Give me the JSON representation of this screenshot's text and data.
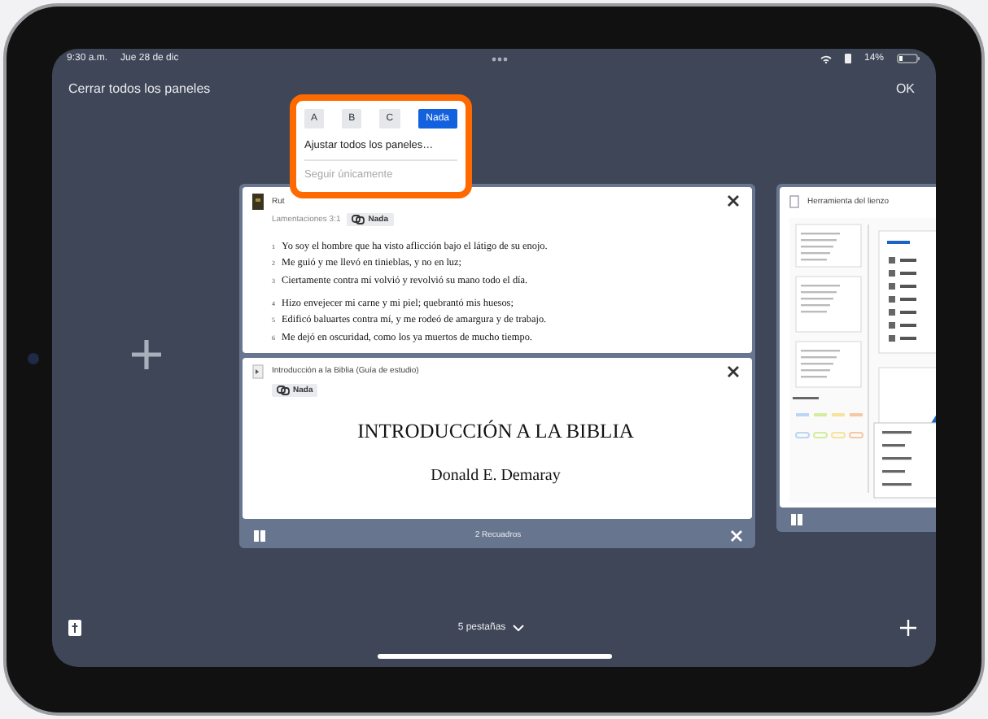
{
  "status_bar": {
    "time": "9:30 a.m.",
    "date": "Jue 28 de dic",
    "battery": "14%"
  },
  "toolbar": {
    "close_all": "Cerrar todos los paneles",
    "done": "OK"
  },
  "popup": {
    "options": [
      {
        "label": "A",
        "selected": false
      },
      {
        "label": "B",
        "selected": false
      },
      {
        "label": "C",
        "selected": false
      },
      {
        "label": "Nada",
        "selected": true
      }
    ],
    "items": [
      {
        "label": "Ajustar todos los paneles…",
        "disabled": false
      },
      {
        "label": "Seguir únicamente",
        "disabled": true
      }
    ]
  },
  "tab_group": {
    "panes": [
      {
        "kind": "bible",
        "title": "Rut",
        "reference": "Lamentaciones 3:1",
        "link": "Nada",
        "paragraphs": [
          {
            "verses": [
              {
                "number": "1",
                "text": "Yo soy el hombre que ha visto aflicción bajo el látigo de su enojo."
              },
              {
                "number": "2",
                "text": "Me guió y me llevó en tinieblas, y no en luz;"
              },
              {
                "number": "3",
                "text": "Ciertamente contra mí volvió y revolvió su mano todo el día."
              }
            ]
          },
          {
            "verses": [
              {
                "number": "4",
                "text": "Hizo envejecer mi carne y mi piel; quebrantó mis huesos;"
              },
              {
                "number": "5",
                "text": "Edificó baluartes contra mí, y me rodeó de amargura y de trabajo."
              },
              {
                "number": "6",
                "text": "Me dejó en oscuridad, como los ya muertos de mucho tiempo."
              }
            ]
          }
        ]
      },
      {
        "kind": "book",
        "title": "Introducción a la Biblia (Guía de estudio)",
        "link": "Nada",
        "heading": "INTRODUCCIÓN A LA BIBLIA",
        "author": "Donald E. Demaray"
      }
    ],
    "footer": "2 Recuadros"
  },
  "side_card": {
    "title": "Herramienta del lienzo"
  },
  "bottom_bar": {
    "tabs": "5 pestañas"
  }
}
